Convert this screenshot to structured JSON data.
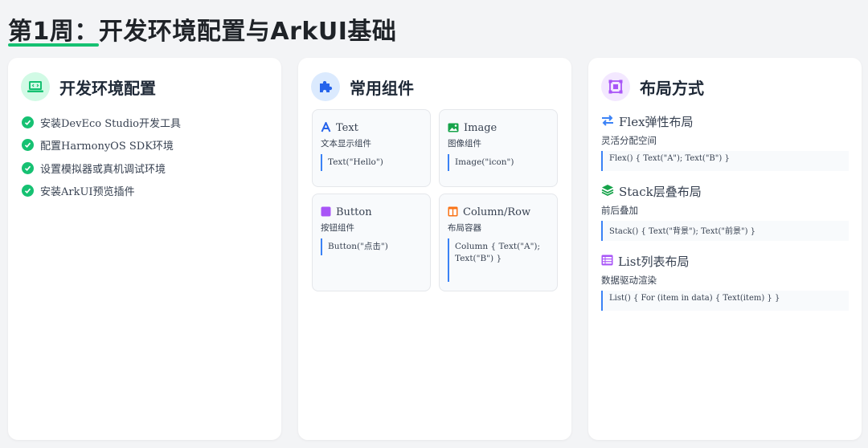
{
  "page": {
    "title": "第1周：开发环境配置与ArkUI基础"
  },
  "theme": {
    "green": "#16c172",
    "blue": "#3b82f6",
    "purple": "#a855f7",
    "orange": "#f97316"
  },
  "env_card": {
    "title": "开发环境配置",
    "icon": "laptop-code-icon",
    "items": [
      {
        "text": "安装DevEco Studio开发工具"
      },
      {
        "text": "配置HarmonyOS SDK环境"
      },
      {
        "text": "设置模拟器或真机调试环境"
      },
      {
        "text": "安装ArkUI预览插件"
      }
    ]
  },
  "components_card": {
    "title": "常用组件",
    "icon": "puzzle-piece-icon",
    "items": [
      {
        "name": "Text",
        "icon": "font-icon",
        "desc": "文本显示组件",
        "code": "Text(\"Hello\")"
      },
      {
        "name": "Image",
        "icon": "image-icon",
        "desc": "图像组件",
        "code": "Image(\"icon\")"
      },
      {
        "name": "Button",
        "icon": "square-icon",
        "desc": "按钮组件",
        "code": "Button(\"点击\")"
      },
      {
        "name": "Column/Row",
        "icon": "columns-icon",
        "desc": "布局容器",
        "code": "Column { Text(\"A\"); Text(\"B\") }"
      }
    ]
  },
  "layout_card": {
    "title": "布局方式",
    "icon": "object-group-icon",
    "sections": [
      {
        "title": "Flex弹性布局",
        "icon": "exchange-arrows-icon",
        "desc": "灵活分配空间",
        "code": "Flex() { Text(\"A\"); Text(\"B\") }"
      },
      {
        "title": "Stack层叠布局",
        "icon": "layer-group-icon",
        "desc": "前后叠加",
        "code": "Stack() { Text(\"背景\"); Text(\"前景\") }"
      },
      {
        "title": "List列表布局",
        "icon": "list-table-icon",
        "desc": "数据驱动渲染",
        "code": "List() { For (item in data) { Text(item) } }"
      }
    ]
  }
}
